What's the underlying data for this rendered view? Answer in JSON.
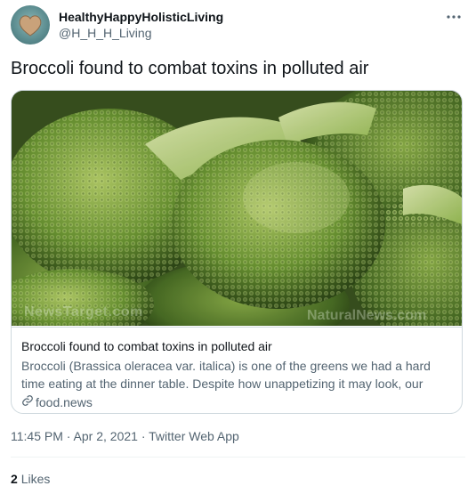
{
  "tweet": {
    "display_name": "HealthyHappyHolisticLiving",
    "handle": "@H_H_H_Living",
    "text": "Broccoli found to combat toxins in polluted air",
    "timestamp": "11:45 PM · Apr 2, 2021 · Twitter Web App",
    "likes_count": "2",
    "likes_label": "Likes"
  },
  "card": {
    "title": "Broccoli found to combat toxins in polluted air",
    "description": "Broccoli (Brassica oleracea var. italica) is one of the greens we had a hard time eating at the dinner table. Despite how unappetizing it may look, our parents h...",
    "domain": "food.news",
    "watermark_left": "NewsTarget.com",
    "watermark_right": "NaturalNews.com"
  },
  "icons": {
    "more": "more-horizontal-icon",
    "link": "link-icon"
  },
  "colors": {
    "text_primary": "#0f1419",
    "text_secondary": "#536471",
    "border": "#cfd9de"
  }
}
